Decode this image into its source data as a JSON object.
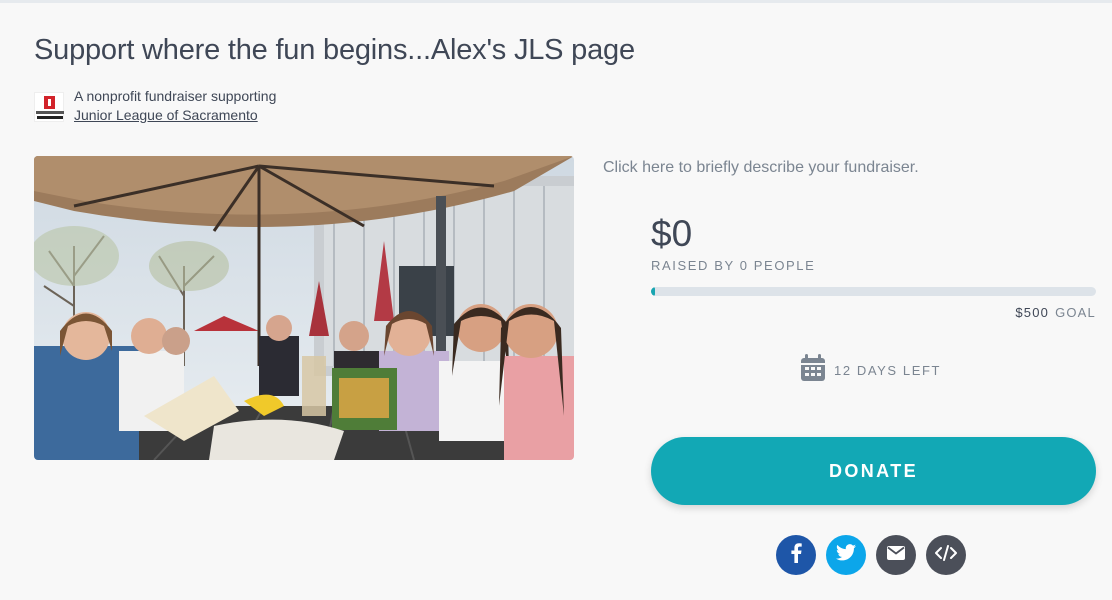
{
  "page": {
    "title": "Support where the fun begins...Alex's JLS page"
  },
  "organization": {
    "supporting_text": "A nonprofit fundraiser supporting",
    "name": "Junior League of Sacramento",
    "logo_icon": "junior-league-logo"
  },
  "hero_image": {
    "description": "group photo on a patio under umbrellas"
  },
  "fundraiser": {
    "description_prompt": "Click here to briefly describe your fundraiser.",
    "raised_amount": "$0",
    "raised_label": "RAISED BY 0 PEOPLE",
    "progress_fraction": 0.01,
    "goal_amount": "$500",
    "goal_label": "GOAL",
    "days_left": "12 DAYS LEFT",
    "calendar_icon": "calendar-icon"
  },
  "actions": {
    "donate_label": "DONATE"
  },
  "share": [
    {
      "name": "facebook",
      "icon": "facebook-icon",
      "color": "#1e56a8"
    },
    {
      "name": "twitter",
      "icon": "twitter-icon",
      "color": "#0ca6ea"
    },
    {
      "name": "email",
      "icon": "email-icon",
      "color": "#4b4f59"
    },
    {
      "name": "embed",
      "icon": "code-icon",
      "color": "#4b4f59"
    }
  ],
  "colors": {
    "accent": "#12a8b5",
    "text": "#3f4756",
    "muted": "#7b8591",
    "background": "#f8f8f8"
  }
}
